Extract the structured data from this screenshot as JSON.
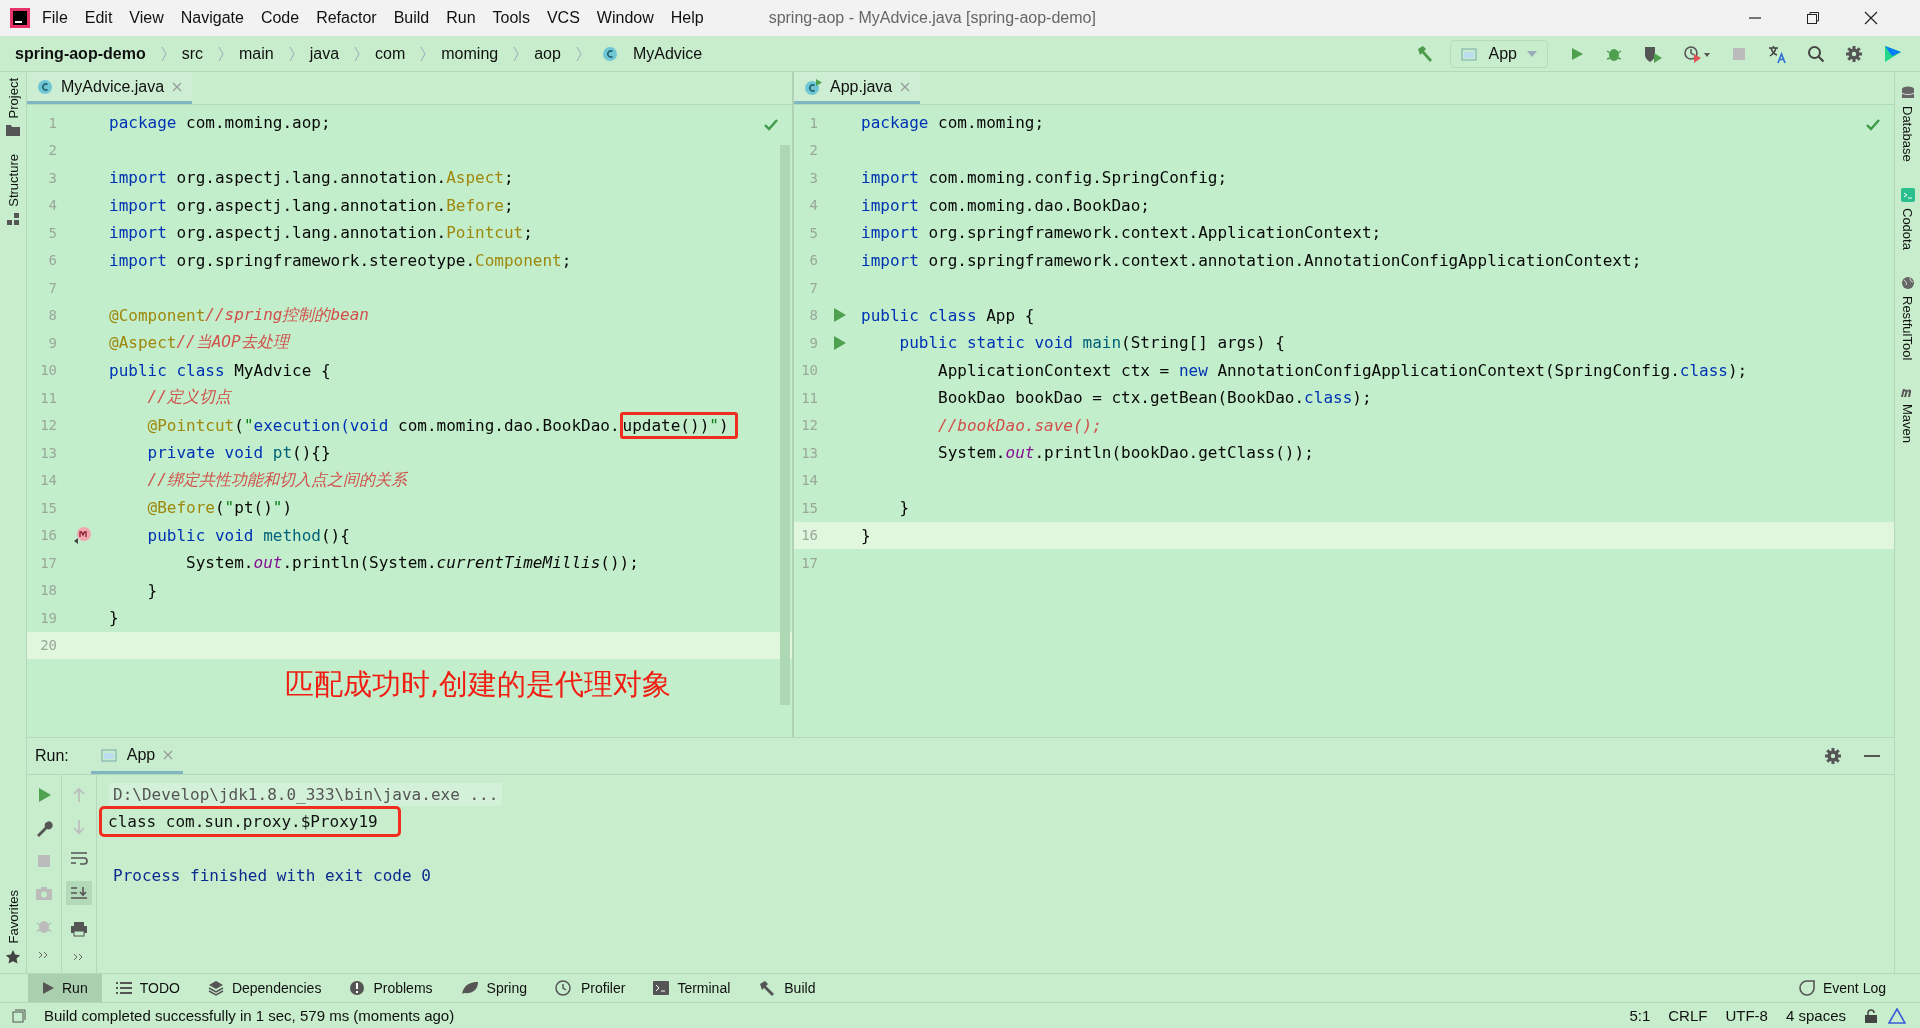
{
  "window": {
    "title": "spring-aop - MyAdvice.java [spring-aop-demo]"
  },
  "menu": [
    "File",
    "Edit",
    "View",
    "Navigate",
    "Code",
    "Refactor",
    "Build",
    "Run",
    "Tools",
    "VCS",
    "Window",
    "Help"
  ],
  "breadcrumb": [
    {
      "label": "spring-aop-demo",
      "kind": "project"
    },
    {
      "label": "src",
      "kind": "folder"
    },
    {
      "label": "main",
      "kind": "folder"
    },
    {
      "label": "java",
      "kind": "folder"
    },
    {
      "label": "com",
      "kind": "folder"
    },
    {
      "label": "moming",
      "kind": "folder"
    },
    {
      "label": "aop",
      "kind": "folder"
    },
    {
      "label": "MyAdvice",
      "kind": "class"
    }
  ],
  "toolbar": {
    "run_config": "App"
  },
  "left_stripe": [
    "Project",
    "Structure"
  ],
  "left_stripe_bottom": "Favorites",
  "right_stripe": [
    "Database",
    "Codota",
    "RestfulTool",
    "Maven"
  ],
  "editors": [
    {
      "tab": "MyAdvice.java",
      "lines": [
        {
          "n": "1",
          "current": false,
          "tokens": [
            {
              "kind": "k",
              "text": "package"
            },
            {
              "kind": "t",
              "text": " com.moming.aop;"
            }
          ]
        },
        {
          "n": "2",
          "current": false
        },
        {
          "n": "3",
          "current": false,
          "tokens": [
            {
              "kind": "k",
              "text": "import"
            },
            {
              "kind": "t",
              "text": " org.aspectj.lang.annotation."
            },
            {
              "kind": "a",
              "text": "Aspect"
            },
            {
              "kind": "t",
              "text": ";"
            }
          ]
        },
        {
          "n": "4",
          "current": false,
          "tokens": [
            {
              "kind": "k",
              "text": "import"
            },
            {
              "kind": "t",
              "text": " org.aspectj.lang.annotation."
            },
            {
              "kind": "a",
              "text": "Before"
            },
            {
              "kind": "t",
              "text": ";"
            }
          ]
        },
        {
          "n": "5",
          "current": false,
          "tokens": [
            {
              "kind": "k",
              "text": "import"
            },
            {
              "kind": "t",
              "text": " org.aspectj.lang.annotation."
            },
            {
              "kind": "a",
              "text": "Pointcut"
            },
            {
              "kind": "t",
              "text": ";"
            }
          ]
        },
        {
          "n": "6",
          "current": false,
          "tokens": [
            {
              "kind": "k",
              "text": "import"
            },
            {
              "kind": "t",
              "text": " org.springframework.stereotype."
            },
            {
              "kind": "a",
              "text": "Component"
            },
            {
              "kind": "t",
              "text": ";"
            }
          ]
        },
        {
          "n": "7",
          "current": false
        },
        {
          "n": "8",
          "current": false,
          "tokens": [
            {
              "kind": "a",
              "text": "@Component"
            },
            {
              "kind": "c",
              "text": "//spring控制的bean"
            }
          ]
        },
        {
          "n": "9",
          "current": false,
          "tokens": [
            {
              "kind": "a",
              "text": "@Aspect"
            },
            {
              "kind": "c",
              "text": "//当AOP去处理"
            }
          ]
        },
        {
          "n": "10",
          "current": false,
          "tokens": [
            {
              "kind": "k",
              "text": "public class"
            },
            {
              "kind": "t",
              "text": " MyAdvice {"
            }
          ]
        },
        {
          "n": "11",
          "current": false,
          "tokens": [
            {
              "kind": "c",
              "text": "    //定义切点"
            }
          ]
        },
        {
          "n": "12",
          "current": false,
          "tokens": [
            {
              "kind": "a",
              "text": "    @Pointcut"
            },
            {
              "kind": "t",
              "text": "("
            },
            {
              "kind": "s",
              "text": "\""
            },
            {
              "kind": "k",
              "text": "execution(void"
            },
            {
              "kind": "t",
              "text": " com.moming.dao.BookDao."
            },
            {
              "kind": "box",
              "tokens": [
                {
                  "kind": "t",
                  "text": "update())"
                },
                {
                  "kind": "s",
                  "text": "\""
                },
                {
                  "kind": "t",
                  "text": ")"
                }
              ]
            }
          ]
        },
        {
          "n": "13",
          "current": false,
          "tokens": [
            {
              "kind": "k",
              "text": "    private void "
            },
            {
              "kind": "m",
              "text": "pt"
            },
            {
              "kind": "t",
              "text": "(){}"
            }
          ]
        },
        {
          "n": "14",
          "current": false,
          "tokens": [
            {
              "kind": "c",
              "text": "    //绑定共性功能和切入点之间的关系"
            }
          ]
        },
        {
          "n": "15",
          "current": false,
          "tokens": [
            {
              "kind": "a",
              "text": "    @Before"
            },
            {
              "kind": "t",
              "text": "("
            },
            {
              "kind": "s",
              "text": "\""
            },
            {
              "kind": "t",
              "text": "pt()"
            },
            {
              "kind": "s",
              "text": "\""
            },
            {
              "kind": "t",
              "text": ")"
            }
          ]
        },
        {
          "n": "16",
          "current": false,
          "kind": "override",
          "tokens": [
            {
              "kind": "k",
              "text": "    public void "
            },
            {
              "kind": "m",
              "text": "method"
            },
            {
              "kind": "t",
              "text": "(){"
            }
          ]
        },
        {
          "n": "17",
          "current": false,
          "tokens": [
            {
              "kind": "t",
              "text": "        System."
            },
            {
              "kind": "f",
              "text": "out"
            },
            {
              "kind": "t",
              "text": ".println(System."
            },
            {
              "kind": "i",
              "text": "currentTimeMillis"
            },
            {
              "kind": "t",
              "text": "());"
            }
          ]
        },
        {
          "n": "18",
          "current": false,
          "tokens": [
            {
              "kind": "t",
              "text": "    }"
            }
          ]
        },
        {
          "n": "19",
          "current": false,
          "tokens": [
            {
              "kind": "t",
              "text": "}"
            }
          ]
        },
        {
          "n": "20",
          "current": true
        }
      ]
    },
    {
      "tab": "App.java",
      "lines": [
        {
          "n": "1",
          "current": false,
          "tokens": [
            {
              "kind": "k",
              "text": "package"
            },
            {
              "kind": "t",
              "text": " com.moming;"
            }
          ]
        },
        {
          "n": "2",
          "current": false
        },
        {
          "n": "3",
          "current": false,
          "tokens": [
            {
              "kind": "k",
              "text": "import"
            },
            {
              "kind": "t",
              "text": " com.moming.config.SpringConfig;"
            }
          ]
        },
        {
          "n": "4",
          "current": false,
          "tokens": [
            {
              "kind": "k",
              "text": "import"
            },
            {
              "kind": "t",
              "text": " com.moming.dao.BookDao;"
            }
          ]
        },
        {
          "n": "5",
          "current": false,
          "tokens": [
            {
              "kind": "k",
              "text": "import"
            },
            {
              "kind": "t",
              "text": " org.springframework.context.ApplicationContext;"
            }
          ]
        },
        {
          "n": "6",
          "current": false,
          "tokens": [
            {
              "kind": "k",
              "text": "import"
            },
            {
              "kind": "t",
              "text": " org.springframework.context.annotation.AnnotationConfigApplicationContext;"
            }
          ]
        },
        {
          "n": "7",
          "current": false
        },
        {
          "n": "8",
          "current": false,
          "kind": "run",
          "tokens": [
            {
              "kind": "k",
              "text": "public class"
            },
            {
              "kind": "t",
              "text": " App {"
            }
          ]
        },
        {
          "n": "9",
          "current": false,
          "kind": "run",
          "tokens": [
            {
              "kind": "k",
              "text": "    public static void "
            },
            {
              "kind": "m",
              "text": "main"
            },
            {
              "kind": "t",
              "text": "(String[] args) {"
            }
          ]
        },
        {
          "n": "10",
          "current": false,
          "tokens": [
            {
              "kind": "t",
              "text": "        ApplicationContext ctx = "
            },
            {
              "kind": "k",
              "text": "new"
            },
            {
              "kind": "t",
              "text": " AnnotationConfigApplicationContext(SpringConfig."
            },
            {
              "kind": "k",
              "text": "class"
            },
            {
              "kind": "t",
              "text": ");"
            }
          ]
        },
        {
          "n": "11",
          "current": false,
          "tokens": [
            {
              "kind": "t",
              "text": "        BookDao bookDao = ctx.getBean(BookDao."
            },
            {
              "kind": "k",
              "text": "class"
            },
            {
              "kind": "t",
              "text": ");"
            }
          ]
        },
        {
          "n": "12",
          "current": false,
          "tokens": [
            {
              "kind": "c",
              "text": "        //bookDao.save();"
            }
          ]
        },
        {
          "n": "13",
          "current": false,
          "tokens": [
            {
              "kind": "t",
              "text": "        System."
            },
            {
              "kind": "f",
              "text": "out"
            },
            {
              "kind": "t",
              "text": ".println(bookDao.getClass());"
            }
          ]
        },
        {
          "n": "14",
          "current": false
        },
        {
          "n": "15",
          "current": false,
          "tokens": [
            {
              "kind": "t",
              "text": "    }"
            }
          ]
        },
        {
          "n": "16",
          "current": true,
          "tokens": [
            {
              "kind": "t",
              "text": "}"
            }
          ]
        },
        {
          "n": "17",
          "current": false
        }
      ]
    }
  ],
  "annotation": "匹配成功时,创建的是代理对象",
  "run_panel": {
    "label": "Run:",
    "tab": "App",
    "console": [
      {
        "kind": "cmd",
        "text": "D:\\Develop\\jdk1.8.0_333\\bin\\java.exe ..."
      },
      {
        "kind": "boxed",
        "text": "class com.sun.proxy.$Proxy19"
      },
      {
        "kind": "blank"
      },
      {
        "kind": "exit",
        "text": "Process finished with exit code 0"
      }
    ]
  },
  "tool_tabs": [
    {
      "label": "Run",
      "selected": true
    },
    {
      "label": "TODO",
      "selected": false
    },
    {
      "label": "Dependencies",
      "selected": false
    },
    {
      "label": "Problems",
      "selected": false
    },
    {
      "label": "Spring",
      "selected": false
    },
    {
      "label": "Profiler",
      "selected": false
    },
    {
      "label": "Terminal",
      "selected": false
    },
    {
      "label": "Build",
      "selected": false
    }
  ],
  "event_log": "Event Log",
  "status": {
    "message": "Build completed successfully in 1 sec, 579 ms (moments ago)",
    "items": [
      "5:1",
      "CRLF",
      "UTF-8",
      "4 spaces"
    ]
  }
}
